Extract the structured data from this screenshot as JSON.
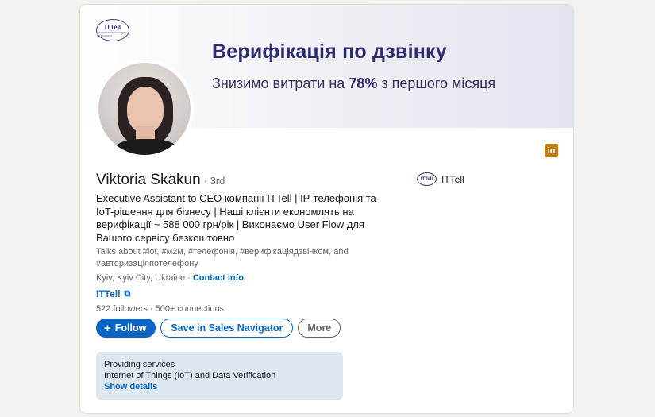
{
  "banner": {
    "logo_text": "ITTell",
    "logo_tagline": "Innovative Technologies for Business",
    "title": "Верифікація по дзвінку",
    "subtitle_prefix": "Знизимо витрати на ",
    "subtitle_bold": "78%",
    "subtitle_suffix": " з першого місяця"
  },
  "profile": {
    "name": "Viktoria Skakun",
    "degree": "· 3rd",
    "headline": "Executive Assistant to CEO компанії ITTell | IP-телефонія та IoT-рішення для бізнесу | Наші клієнти економлять на верифікації ~ 588 000 грн/рік | Виконаємо User Flow для Вашого сервісу безкоштовно",
    "talks_about": "Talks about #iot, #м2м, #телефонія, #верифікаціядзвінком, and #авторизаціяпотелефону",
    "location": "Kyiv, Kyiv City, Ukraine · ",
    "contact_info": "Contact info",
    "company_link": "ITTell",
    "followers": "522 followers",
    "connections": " · 500+ connections"
  },
  "actions": {
    "follow_label": "Follow",
    "follow_icon": "+",
    "navigator_label": "Save in Sales Navigator",
    "more_label": "More"
  },
  "services": {
    "title": "Providing services",
    "description": "Internet of Things (IoT) and Data Verification",
    "link": "Show details"
  },
  "experience": {
    "company_logo_text": "ITTell",
    "company_name": "ITTell"
  },
  "icons": {
    "linkedin_badge": "in",
    "external_link": "⧉"
  },
  "colors": {
    "accent": "#0a66c2",
    "banner_title": "#2d2a6e",
    "linkedin_badge": "#c37d16",
    "services_bg": "#dde7f1"
  }
}
